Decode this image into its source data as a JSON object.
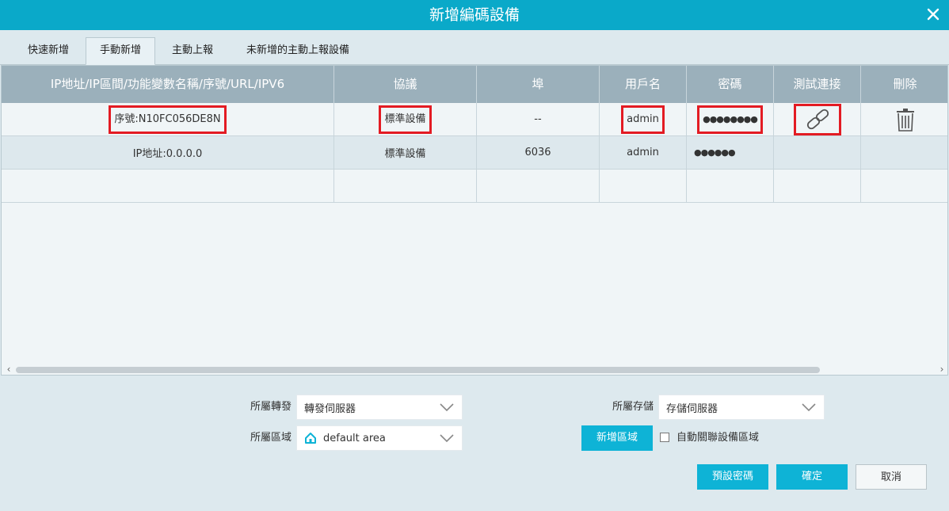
{
  "window": {
    "title": "新增編碼設備"
  },
  "tabs": [
    {
      "label": "快速新增"
    },
    {
      "label": "手動新增"
    },
    {
      "label": "主動上報"
    },
    {
      "label": "未新增的主動上報設備"
    }
  ],
  "table": {
    "headers": [
      "IP地址/IP區間/功能變數名稱/序號/URL/IPV6",
      "協議",
      "埠",
      "用戶名",
      "密碼",
      "測試連接",
      "刪除"
    ],
    "rows": [
      {
        "address": "序號:N10FC056DE8N",
        "protocol": "標準設備",
        "port": "--",
        "username": "admin",
        "password": "●●●●●●●●"
      },
      {
        "address": "IP地址:0.0.0.0",
        "protocol": "標準設備",
        "port": "6036",
        "username": "admin",
        "password": "●●●●●●"
      }
    ],
    "scroll_left": "‹",
    "scroll_right": "›"
  },
  "form": {
    "forward_label": "所屬轉發",
    "forward_value": "轉發伺服器",
    "storage_label": "所屬存儲",
    "storage_value": "存儲伺服器",
    "area_label": "所屬區域",
    "area_value": "default area",
    "add_area_button": "新增區域",
    "auto_associate_label": "自動關聯設備區域",
    "auto_associate_checked": false
  },
  "buttons": {
    "default_password": "預設密碼",
    "confirm": "確定",
    "cancel": "取消"
  },
  "colors": {
    "accent": "#0aa9c9",
    "highlight": "#e31b23",
    "header": "#9bb0bb"
  }
}
